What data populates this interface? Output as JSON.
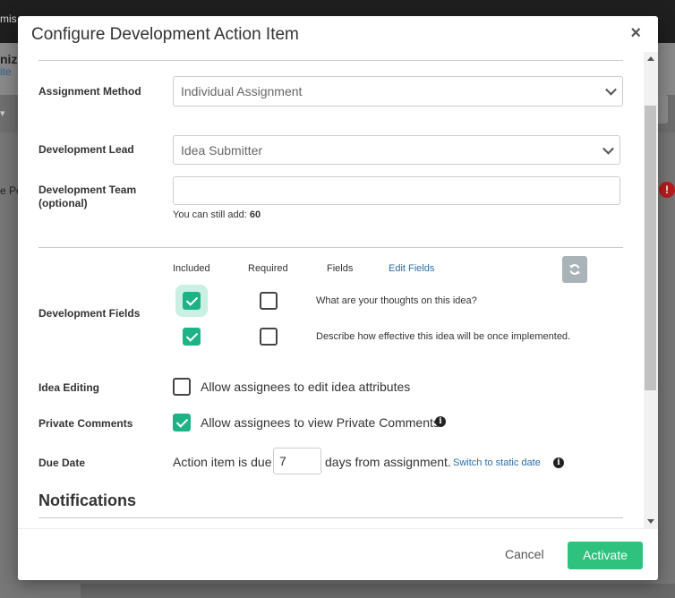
{
  "background": {
    "topbar_text": "mis",
    "sub_title": "nize",
    "sub_link": "ite",
    "side_label": "e Pe"
  },
  "modal": {
    "title": "Configure Development Action Item",
    "close_label": "×"
  },
  "form": {
    "assignment_method": {
      "label": "Assignment Method",
      "value": "Individual Assignment"
    },
    "development_lead": {
      "label": "Development Lead",
      "value": "Idea Submitter"
    },
    "development_team": {
      "label_line1": "Development Team",
      "label_line2": "(optional)",
      "value": "",
      "remaining_prefix": "You can still add: ",
      "remaining_count": "60"
    },
    "development_fields": {
      "label": "Development Fields",
      "col_included": "Included",
      "col_required": "Required",
      "col_fields": "Fields",
      "edit_fields_link": "Edit Fields",
      "rows": [
        {
          "included": true,
          "required": false,
          "text": "What are your thoughts on this idea?"
        },
        {
          "included": true,
          "required": false,
          "text": "Describe how effective this idea will be once implemented."
        }
      ]
    },
    "idea_editing": {
      "label": "Idea Editing",
      "checked": false,
      "text": "Allow assignees to edit idea attributes"
    },
    "private_comments": {
      "label": "Private Comments",
      "checked": true,
      "text": "Allow assignees to view Private Comments"
    },
    "due_date": {
      "label": "Due Date",
      "prefix": "Action item is due",
      "value": "7",
      "suffix": "days from assignment.",
      "switch_link": "Switch to static date"
    },
    "notifications_heading": "Notifications"
  },
  "footer": {
    "cancel_label": "Cancel",
    "activate_label": "Activate"
  },
  "colors": {
    "accent": "#1eb386",
    "activate": "#2ec27e",
    "link": "#2a6ea6"
  }
}
